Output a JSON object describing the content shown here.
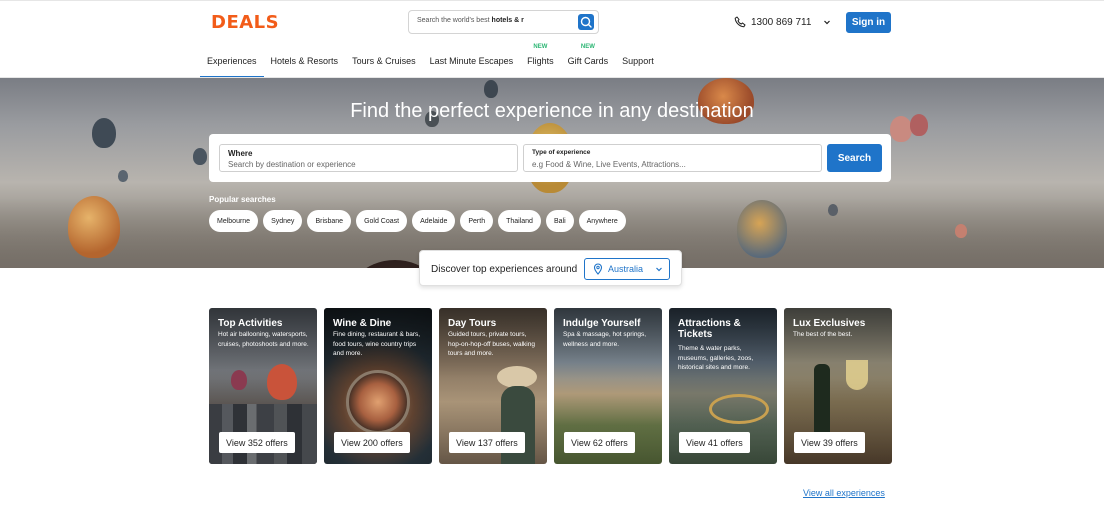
{
  "header": {
    "logo": "DEALS",
    "search": {
      "prefix": "Search the world's best",
      "term": "hotels & r"
    },
    "phone": "1300 869 711",
    "signin": "Sign in"
  },
  "nav": [
    {
      "label": "Experiences",
      "badge": ""
    },
    {
      "label": "Hotels & Resorts",
      "badge": ""
    },
    {
      "label": "Tours & Cruises",
      "badge": ""
    },
    {
      "label": "Last Minute Escapes",
      "badge": ""
    },
    {
      "label": "Flights",
      "badge": "NEW"
    },
    {
      "label": "Gift Cards",
      "badge": "NEW"
    },
    {
      "label": "Support",
      "badge": ""
    }
  ],
  "hero": {
    "title": "Find the perfect experience in any destination",
    "where": {
      "label": "Where",
      "placeholder": "Search by destination or experience"
    },
    "type": {
      "label": "Type of experience",
      "placeholder": "e.g Food & Wine, Live Events, Attractions..."
    },
    "search_button": "Search",
    "popular_title": "Popular searches",
    "popular": [
      "Melbourne",
      "Sydney",
      "Brisbane",
      "Gold Coast",
      "Adelaide",
      "Perth",
      "Thailand",
      "Bali",
      "Anywhere"
    ]
  },
  "discover": {
    "text": "Discover top experiences around",
    "value": "Australia"
  },
  "cards": [
    {
      "title": "Top Activities",
      "desc": "Hot air ballooning, watersports, cruises, photoshoots and more.",
      "button": "View 352 offers"
    },
    {
      "title": "Wine & Dine",
      "desc": "Fine dining, restaurant & bars, food tours, wine country trips and more.",
      "button": "View 200 offers"
    },
    {
      "title": "Day Tours",
      "desc": "Guided tours, private tours, hop-on-hop-off buses, walking tours and more.",
      "button": "View 137 offers"
    },
    {
      "title": "Indulge Yourself",
      "desc": "Spa & massage, hot springs, wellness and more.",
      "button": "View 62 offers"
    },
    {
      "title": "Attractions & Tickets",
      "desc": "Theme & water parks, museums, galleries, zoos, historical sites and more.",
      "button": "View 41 offers"
    },
    {
      "title": "Lux Exclusives",
      "desc": "The best of the best.",
      "button": "View 39 offers"
    }
  ],
  "view_all": "View all experiences",
  "colors": {
    "brand_orange": "#f25c19",
    "primary_blue": "#1f74c9",
    "new_green": "#2bb673"
  }
}
